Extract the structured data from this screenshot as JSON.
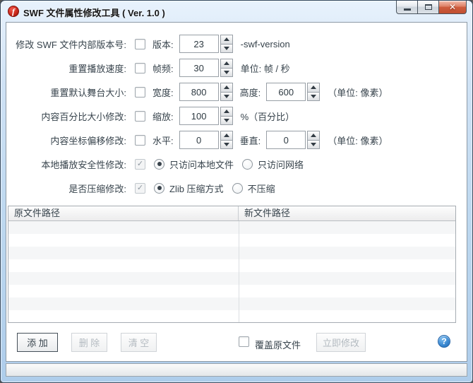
{
  "window": {
    "title": "SWF 文件属性修改工具 ( Ver. 1.0 )"
  },
  "colors": {
    "close_button_red": "#cf5c3e",
    "help_icon_blue": "#2d7dc8",
    "frame_blue": "#bcd7ef"
  },
  "form": {
    "rows": [
      {
        "label": "修改 SWF 文件内部版本号:",
        "checked": false,
        "fields": [
          {
            "label": "版本:",
            "value": "23"
          }
        ],
        "suffix": "-swf-version"
      },
      {
        "label": "重置播放速度:",
        "checked": false,
        "fields": [
          {
            "label": "帧频:",
            "value": "30"
          }
        ],
        "suffix": "单位: 帧 / 秒"
      },
      {
        "label": "重置默认舞台大小:",
        "checked": false,
        "fields": [
          {
            "label": "宽度:",
            "value": "800"
          },
          {
            "label": "高度:",
            "value": "600"
          }
        ],
        "suffix": "（单位: 像素）"
      },
      {
        "label": "内容百分比大小修改:",
        "checked": false,
        "fields": [
          {
            "label": "缩放:",
            "value": "100"
          }
        ],
        "suffix": "%（百分比）"
      },
      {
        "label": "内容坐标偏移修改:",
        "checked": false,
        "fields": [
          {
            "label": "水平:",
            "value": "0"
          },
          {
            "label": "垂直:",
            "value": "0"
          }
        ],
        "suffix": "（单位: 像素）"
      },
      {
        "label": "本地播放安全性修改:",
        "checked": true,
        "disabled": true,
        "radios": [
          {
            "label": "只访问本地文件",
            "selected": true
          },
          {
            "label": "只访问网络",
            "selected": false
          }
        ]
      },
      {
        "label": "是否压缩修改:",
        "checked": true,
        "disabled": true,
        "radios": [
          {
            "label": "Zlib 压缩方式",
            "selected": true
          },
          {
            "label": "不压缩",
            "selected": false
          }
        ]
      }
    ]
  },
  "table": {
    "columns": [
      "原文件路径",
      "新文件路径"
    ],
    "rows": []
  },
  "footer": {
    "add_button": "添 加",
    "delete_button": "删 除",
    "clear_button": "清 空",
    "overwrite_checkbox_label": "覆盖原文件",
    "modify_button": "立即修改",
    "help_icon": "?"
  },
  "checkmark_glyph": "✓"
}
